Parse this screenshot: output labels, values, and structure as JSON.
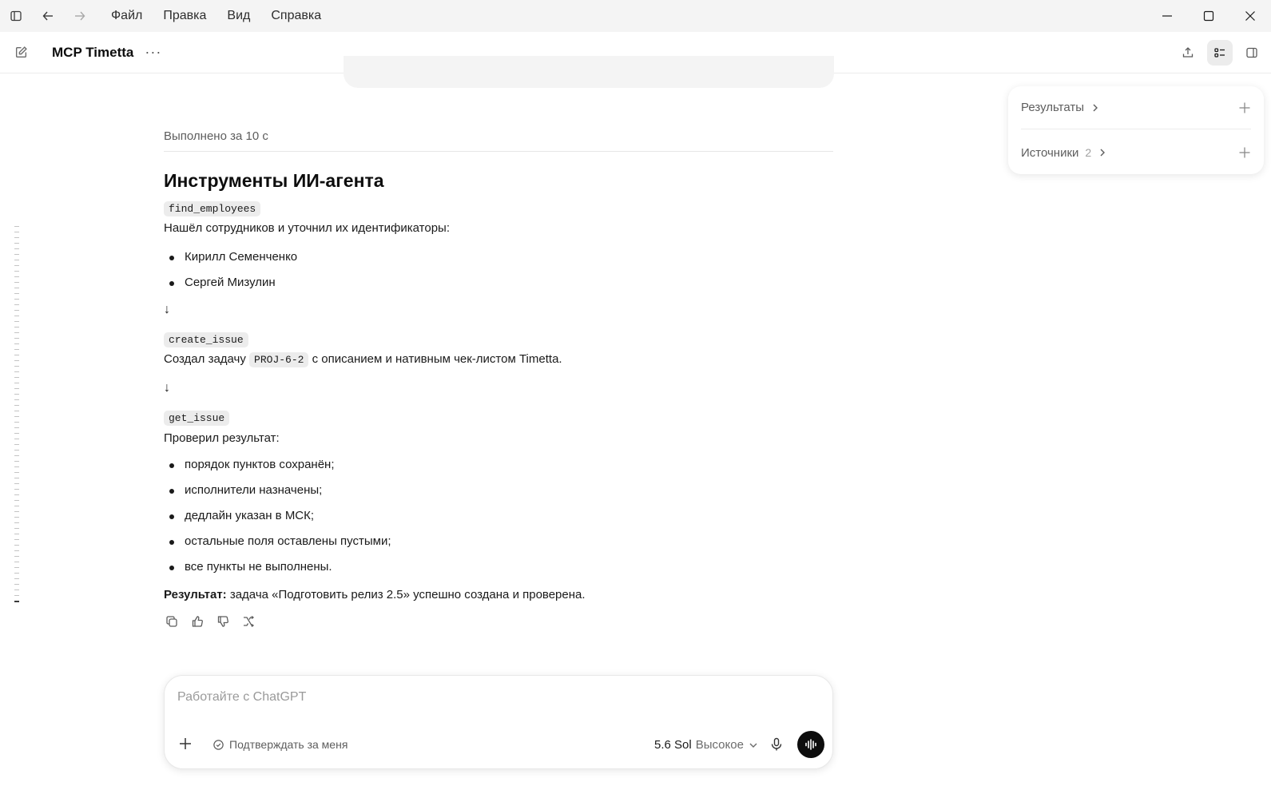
{
  "menu": [
    "Файл",
    "Правка",
    "Вид",
    "Справка"
  ],
  "header": {
    "title": "MCP Timetta",
    "more": "···"
  },
  "content": {
    "done": "Выполнено за 10 с",
    "heading": "Инструменты ИИ-агента",
    "tool1": "find_employees",
    "tool1_text": "Нашёл сотрудников и уточнил их идентификаторы:",
    "employees": [
      "Кирилл Семенченко",
      "Сергей Мизулин"
    ],
    "arrow": "↓",
    "tool2": "create_issue",
    "tool2_pre": "Создал задачу",
    "tool2_code": "PROJ-6-2",
    "tool2_post": "с описанием и нативным чек-листом Timetta.",
    "tool3": "get_issue",
    "tool3_text": "Проверил результат:",
    "checks": [
      "порядок пунктов сохранён;",
      "исполнители назначены;",
      "дедлайн указан в МСК;",
      "остальные поля оставлены пустыми;",
      "все пункты не выполнены."
    ],
    "result_label": "Результат:",
    "result_text": " задача «Подготовить релиз 2.5» успешно создана и проверена."
  },
  "side": {
    "results_label": "Результаты",
    "sources_label": "Источники",
    "sources_count": "2"
  },
  "composer": {
    "placeholder": "Работайте с ChatGPT",
    "approve": "Подтверждать за меня",
    "model": "5.6 Sol",
    "level": "Высокое"
  }
}
